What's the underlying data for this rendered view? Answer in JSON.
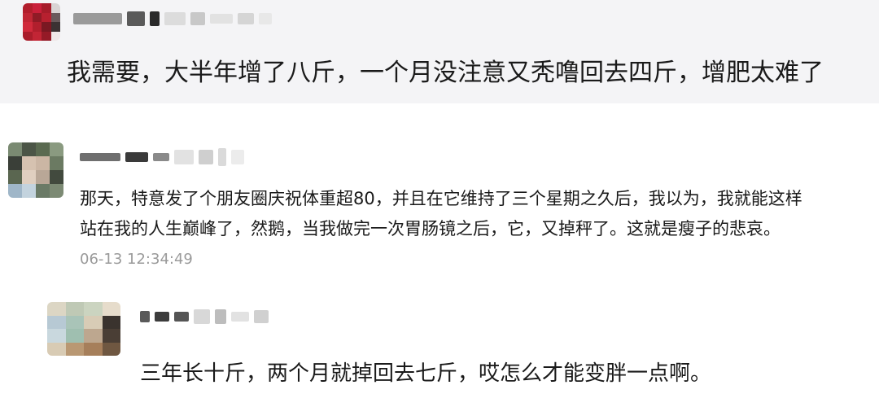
{
  "comments": [
    {
      "text": "我需要，大半年增了八斤，一个月没注意又秃噜回去四斤，增肥太难了"
    },
    {
      "text_line1": "那天，特意发了个朋友圈庆祝体重超80，并且在它维持了三个星期之久后，我以为，我就能这样",
      "text_line2": "站在我的人生巅峰了，然鹅，当我做完一次胃肠镜之后，它，又掉秤了。这就是瘦子的悲哀。",
      "timestamp": "06-13 12:34:49"
    },
    {
      "text": "三年长十斤，两个月就掉回去七斤，哎怎么才能变胖一点啊。"
    }
  ],
  "colors": {
    "top_background": "#f4f4f6",
    "text": "#1a1a1a",
    "timestamp": "#9a9a9a"
  },
  "icons": [
    "pixelated-avatar-1",
    "pixelated-avatar-2",
    "pixelated-avatar-3"
  ]
}
